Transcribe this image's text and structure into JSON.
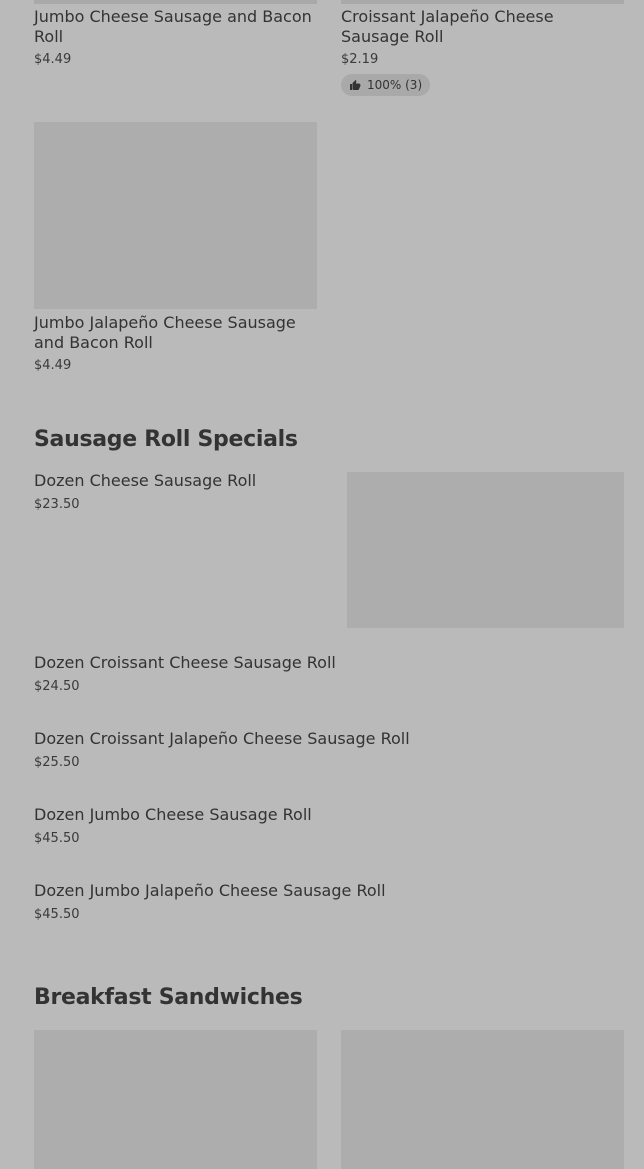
{
  "top_cards": [
    {
      "name": "Jumbo Cheese Sausage and Bacon Roll",
      "price": "$4.49"
    },
    {
      "name": "Croissant Jalapeño Cheese Sausage Roll",
      "price": "$2.19",
      "rating": "100% (3)"
    }
  ],
  "card_item": {
    "name": "Jumbo Jalapeño Cheese Sausage and Bacon Roll",
    "price": "$4.49"
  },
  "sausage_roll_specials": {
    "title": "Sausage Roll Specials",
    "items": [
      {
        "name": "Dozen Cheese Sausage Roll",
        "price": "$23.50"
      },
      {
        "name": "Dozen Croissant Cheese Sausage Roll",
        "price": "$24.50"
      },
      {
        "name": "Dozen Croissant Jalapeño Cheese Sausage Roll",
        "price": "$25.50"
      },
      {
        "name": "Dozen Jumbo Cheese Sausage Roll",
        "price": "$45.50"
      },
      {
        "name": "Dozen Jumbo Jalapeño Cheese Sausage Roll",
        "price": "$45.50"
      }
    ]
  },
  "breakfast_sandwiches": {
    "title": "Breakfast Sandwiches"
  },
  "colors": {
    "background": "#bababa",
    "image_placeholder": "#adadad",
    "text": "#333333"
  }
}
